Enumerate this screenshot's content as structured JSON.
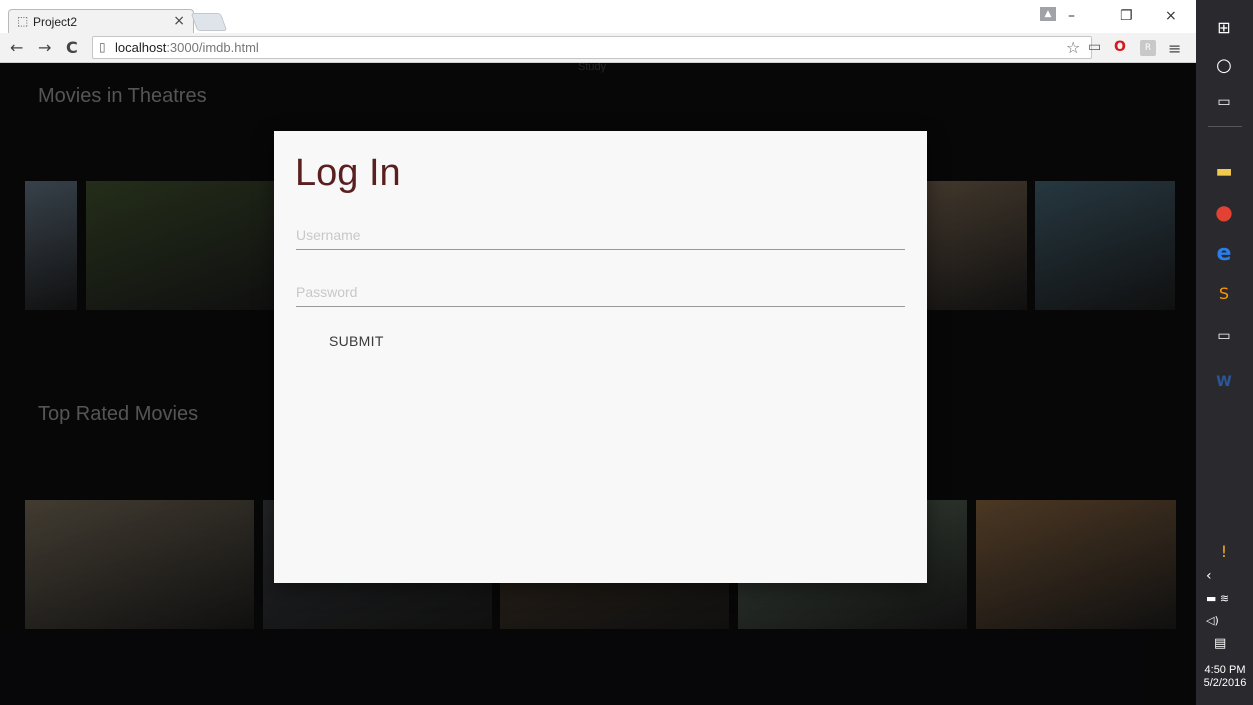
{
  "browser": {
    "tab_title": "Project2",
    "tab_favicon": "page-icon",
    "tab_close": "×",
    "url_host": "localhost",
    "url_rest": ":3000/imdb.html",
    "back": "←",
    "forward": "→",
    "reload": "C",
    "minimize": "–",
    "restore": "❐",
    "close": "×",
    "bookmark": "☆",
    "menu": "≡"
  },
  "page": {
    "faded_nav": "Study",
    "sections": [
      {
        "title": "Movies in Theatres"
      },
      {
        "title": "Top Rated Movies"
      }
    ],
    "poster_colors_row1": [
      "#5a6a78",
      "#3a4a2a",
      "#6a5a48",
      "#5c4c3c",
      "#3e5a68"
    ],
    "poster_colors_row2": [
      "#6a6050",
      "#3a3c40",
      "#4a3a2a",
      "#5a6a5a",
      "#7a5a3a"
    ]
  },
  "login": {
    "title": "Log In",
    "username_placeholder": "Username",
    "password_placeholder": "Password",
    "submit_label": "SUBMIT"
  },
  "taskbar": {
    "time": "4:50 PM",
    "date": "5/2/2016",
    "icons": [
      "windows-icon",
      "cortana-icon",
      "task-view-icon",
      "file-explorer-icon",
      "chrome-icon",
      "edge-icon",
      "sublime-icon",
      "terminal-icon",
      "word-icon"
    ]
  }
}
